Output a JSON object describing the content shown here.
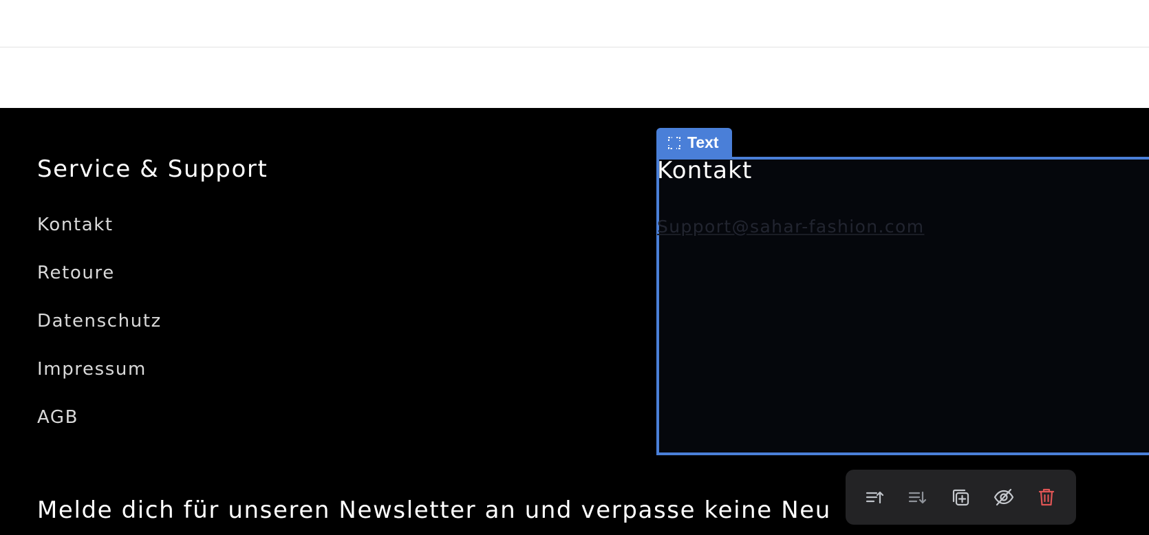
{
  "footer": {
    "service": {
      "heading": "Service & Support",
      "links": [
        "Kontakt",
        "Retoure",
        "Datenschutz",
        "Impressum",
        "AGB"
      ]
    },
    "contact": {
      "title": "Kontakt",
      "email": "Support@sahar-fashion.com"
    },
    "newsletter_text": "Melde dich für unseren Newsletter an und verpasse keine Neu"
  },
  "editor": {
    "selection_label": "Text",
    "accent_color": "#4a7fd8",
    "toolbar": {
      "icons": [
        "move-up-icon",
        "move-down-icon",
        "duplicate-icon",
        "hide-icon",
        "delete-icon"
      ],
      "delete_color": "#e05555"
    }
  }
}
